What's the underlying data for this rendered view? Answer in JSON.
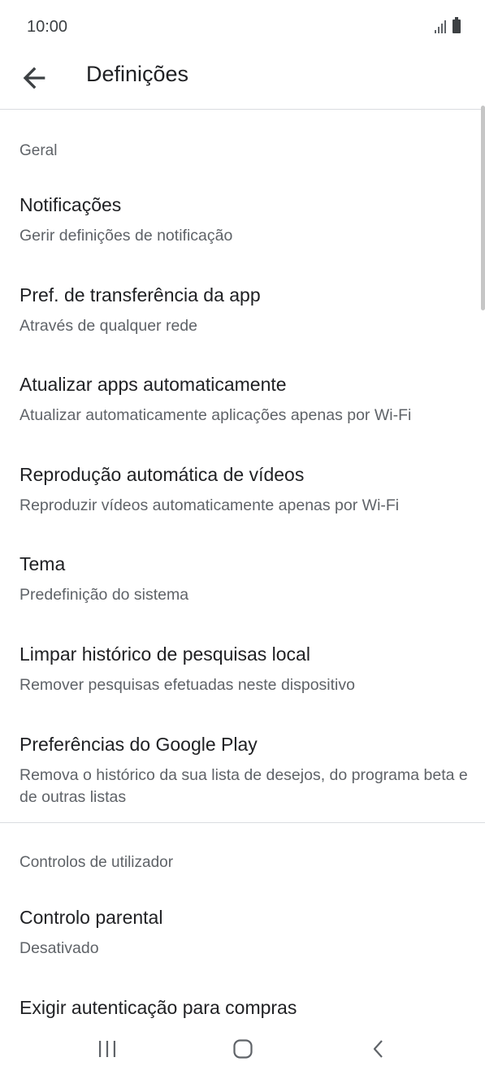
{
  "status_bar": {
    "time": "10:00"
  },
  "app_bar": {
    "title": "Definições"
  },
  "sections": {
    "general": {
      "header": "Geral",
      "items": [
        {
          "title": "Notificações",
          "subtitle": "Gerir definições de notificação"
        },
        {
          "title": "Pref. de transferência da app",
          "subtitle": "Através de qualquer rede"
        },
        {
          "title": "Atualizar apps automaticamente",
          "subtitle": "Atualizar automaticamente aplicações apenas por Wi-Fi"
        },
        {
          "title": "Reprodução automática de vídeos",
          "subtitle": "Reproduzir vídeos automaticamente apenas por Wi-Fi"
        },
        {
          "title": "Tema",
          "subtitle": "Predefinição do sistema"
        },
        {
          "title": "Limpar histórico de pesquisas local",
          "subtitle": "Remover pesquisas efetuadas neste dispositivo"
        },
        {
          "title": "Preferências do Google Play",
          "subtitle": "Remova o histórico da sua lista de desejos, do programa beta e de outras listas"
        }
      ]
    },
    "user_controls": {
      "header": "Controlos de utilizador",
      "items": [
        {
          "title": "Controlo parental",
          "subtitle": "Desativado"
        },
        {
          "title": "Exigir autenticação para compras"
        }
      ]
    }
  },
  "icons": {
    "back": "arrow-back-icon",
    "nav_recents": "recents-icon",
    "nav_home": "home-icon",
    "nav_back": "nav-back-icon"
  },
  "colors": {
    "text_primary": "#202124",
    "text_secondary": "#5f6368",
    "divider": "#dadce0"
  }
}
